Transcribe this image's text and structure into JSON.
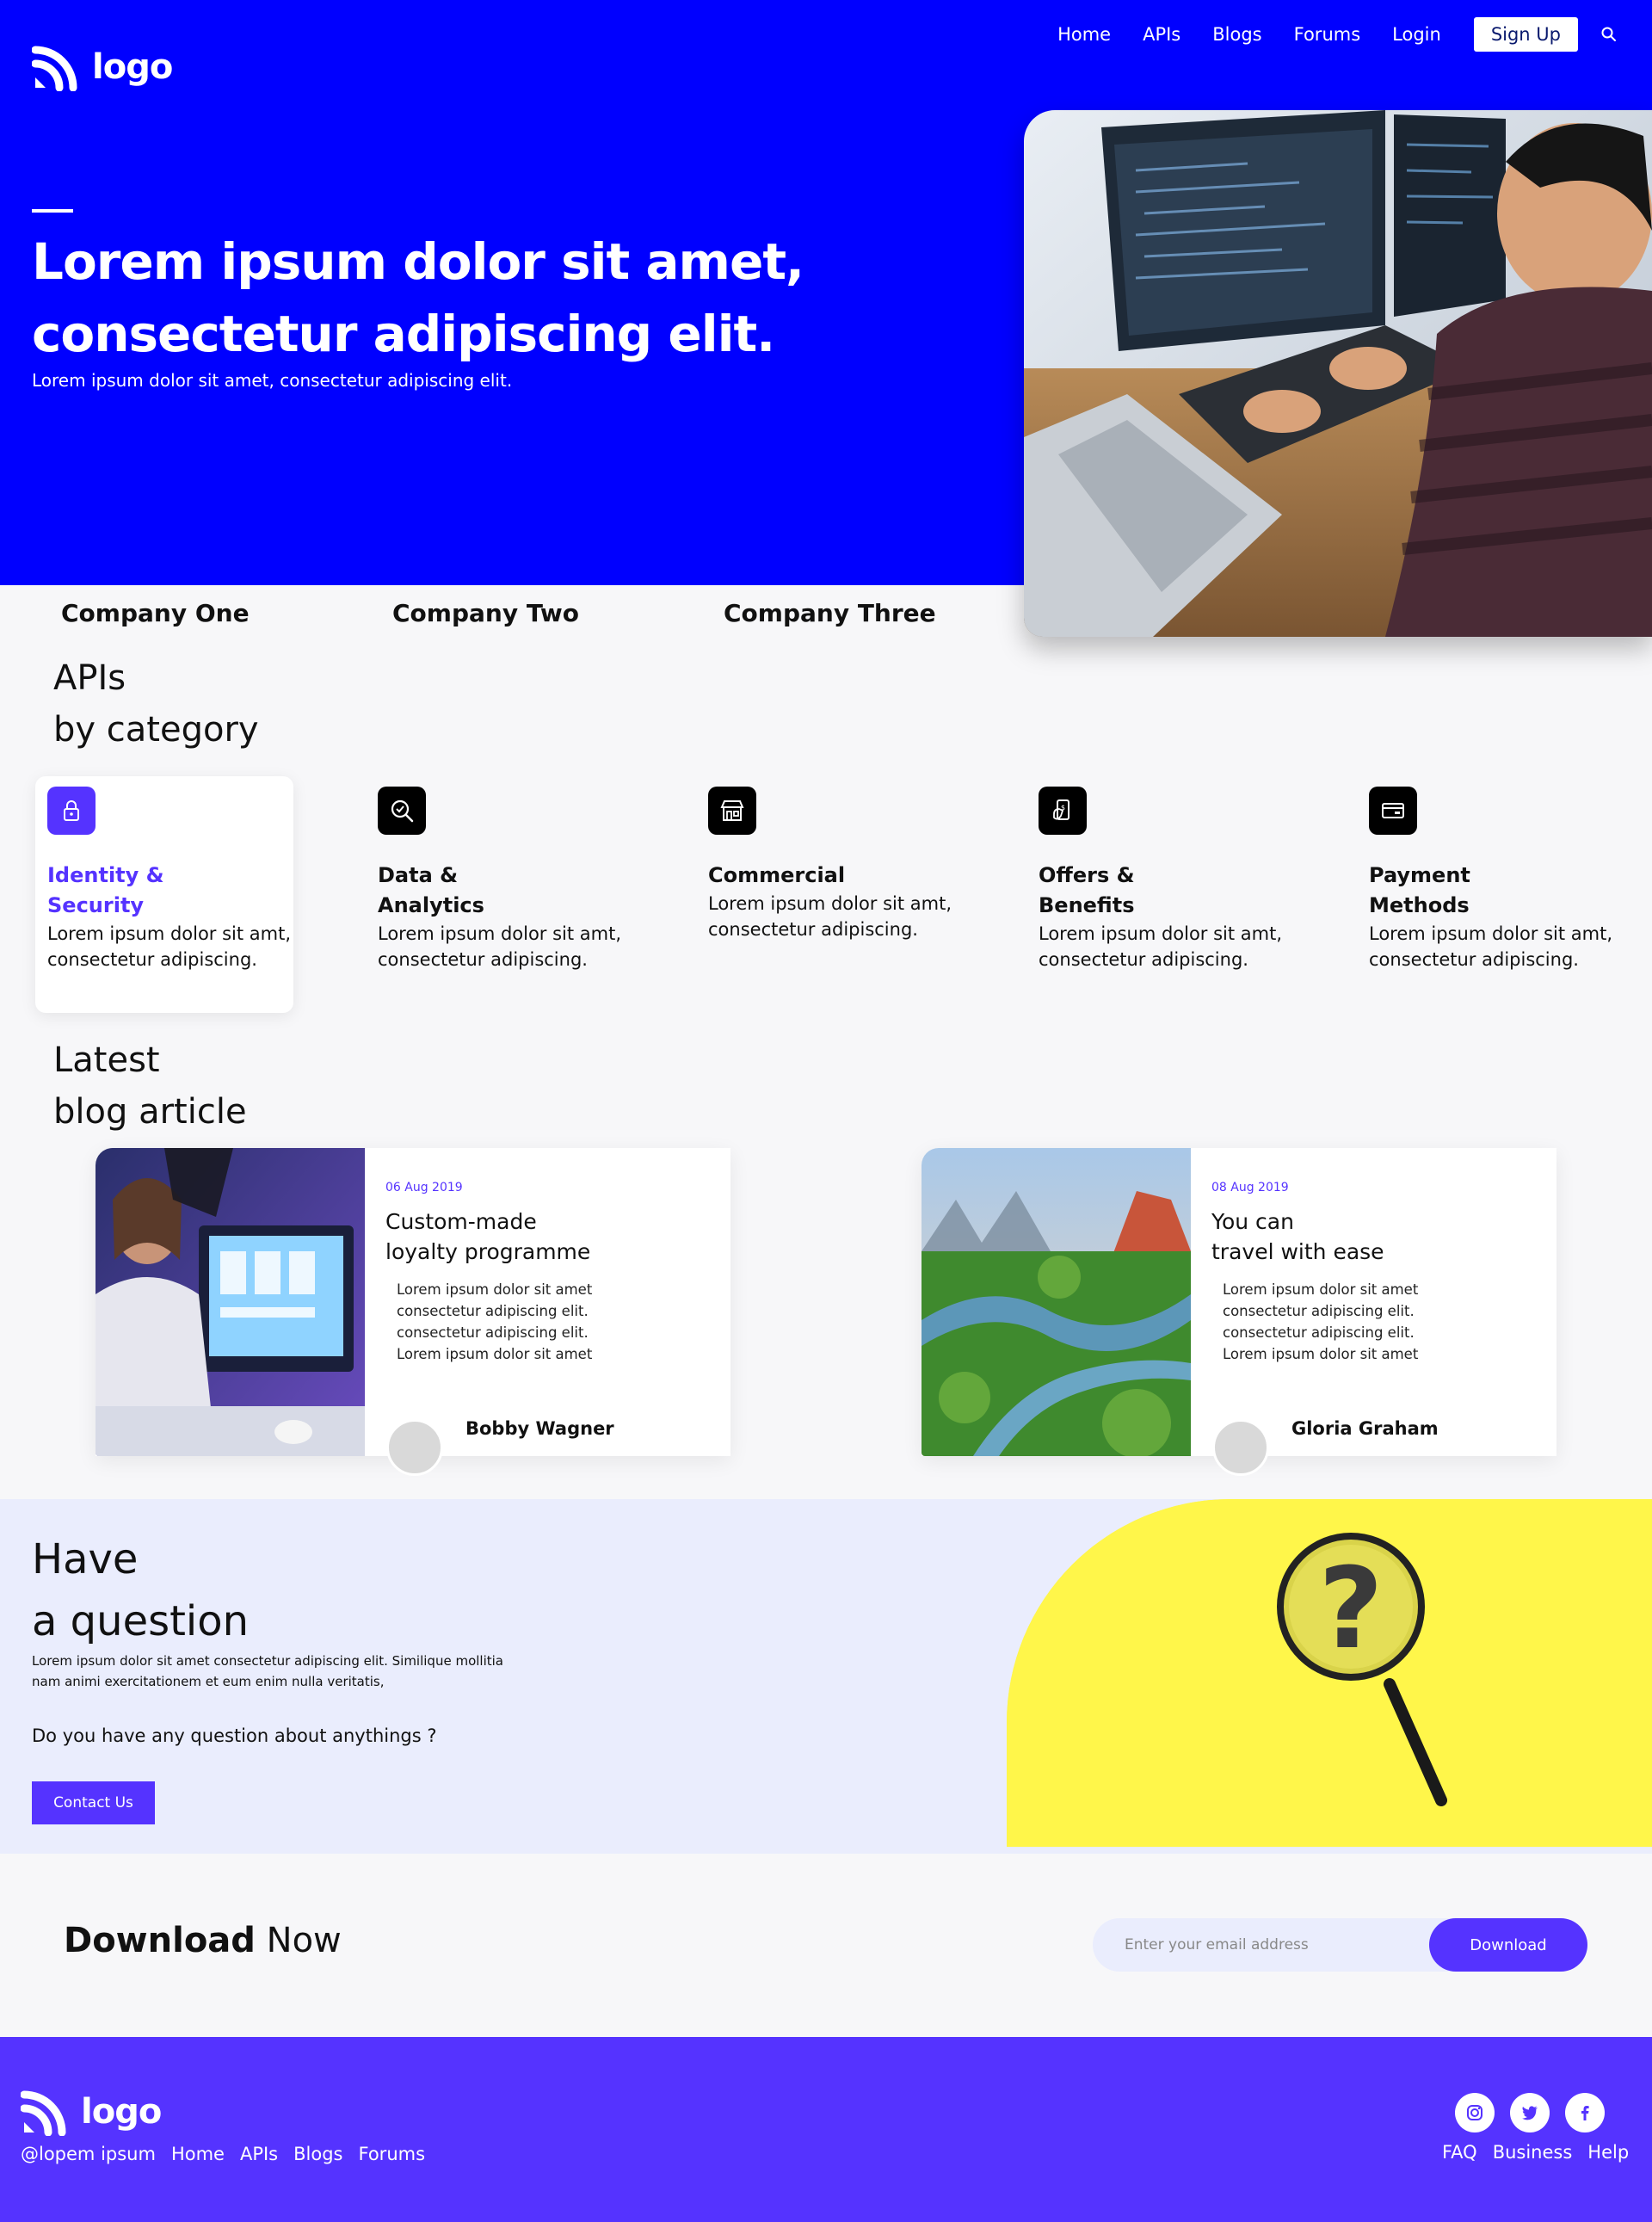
{
  "brand": {
    "logo_text": "logo"
  },
  "nav": {
    "items": [
      "Home",
      "APIs",
      "Blogs",
      "Forums",
      "Login"
    ],
    "signup_label": "Sign Up"
  },
  "hero": {
    "title_line1": "Lorem ipsum dolor sit amet,",
    "title_line2": "consectetur adipiscing elit.",
    "subtitle": "Lorem ipsum dolor sit amet, consectetur adipiscing elit."
  },
  "companies": [
    "Company One",
    "Company Two",
    "Company Three"
  ],
  "categories": {
    "heading_line1": "APIs",
    "heading_line2": "by category",
    "items": [
      {
        "title_line1": "Identity &",
        "title_line2": "Security",
        "description": "Lorem ipsum dolor sit amt, consectetur adipiscing.",
        "icon": "lock-icon"
      },
      {
        "title_line1": "Data &",
        "title_line2": "Analytics",
        "description": "Lorem ipsum dolor sit amt, consectetur adipiscing.",
        "icon": "magnifier-check-icon"
      },
      {
        "title_line1": "Commercial",
        "title_line2": "",
        "description": "Lorem ipsum dolor sit amt, consectetur adipiscing.",
        "icon": "storefront-icon"
      },
      {
        "title_line1": "Offers &",
        "title_line2": "Benefits",
        "description": "Lorem ipsum dolor sit amt, consectetur adipiscing.",
        "icon": "mobile-pay-icon"
      },
      {
        "title_line1": "Payment",
        "title_line2": "Methods",
        "description": "Lorem ipsum dolor sit amt, consectetur adipiscing.",
        "icon": "card-icon"
      }
    ]
  },
  "blog": {
    "heading_line1": "Latest",
    "heading_line2": "blog article",
    "articles": [
      {
        "date": "06 Aug 2019",
        "title_line1": "Custom-made",
        "title_line2": "loyalty programme",
        "excerpt": "Lorem ipsum dolor sit amet\nconsectetur adipiscing elit.\nconsectetur adipiscing elit.\nLorem ipsum dolor sit amet",
        "author": "Bobby Wagner"
      },
      {
        "date": "08 Aug 2019",
        "title_line1": "You can",
        "title_line2": "travel with ease",
        "excerpt": "Lorem ipsum dolor sit amet\nconsectetur adipiscing elit.\nconsectetur adipiscing elit.\nLorem ipsum dolor sit amet",
        "author": "Gloria Graham"
      }
    ]
  },
  "question": {
    "title_line1": "Have",
    "title_line2": "a question",
    "text": "Lorem ipsum dolor sit amet consectetur adipiscing elit. Similique mollitia nam animi exercitationem et eum enim nulla veritatis,",
    "ask": "Do you have any question about anythings ?",
    "contact_label": "Contact Us"
  },
  "download": {
    "title_bold": "Download",
    "title_light": "Now",
    "placeholder": "Enter your email address",
    "button_label": "Download"
  },
  "footer": {
    "handle": "@lopem ipsum",
    "links": [
      "Home",
      "APIs",
      "Blogs",
      "Forums"
    ],
    "right_links": [
      "FAQ",
      "Business",
      "Help"
    ],
    "social": [
      "instagram-icon",
      "twitter-icon",
      "facebook-icon"
    ]
  },
  "colors": {
    "hero_blue": "#0000ff",
    "accent": "#5533ff",
    "question_bg": "#eaedfd",
    "yellow": "#fff64a"
  }
}
